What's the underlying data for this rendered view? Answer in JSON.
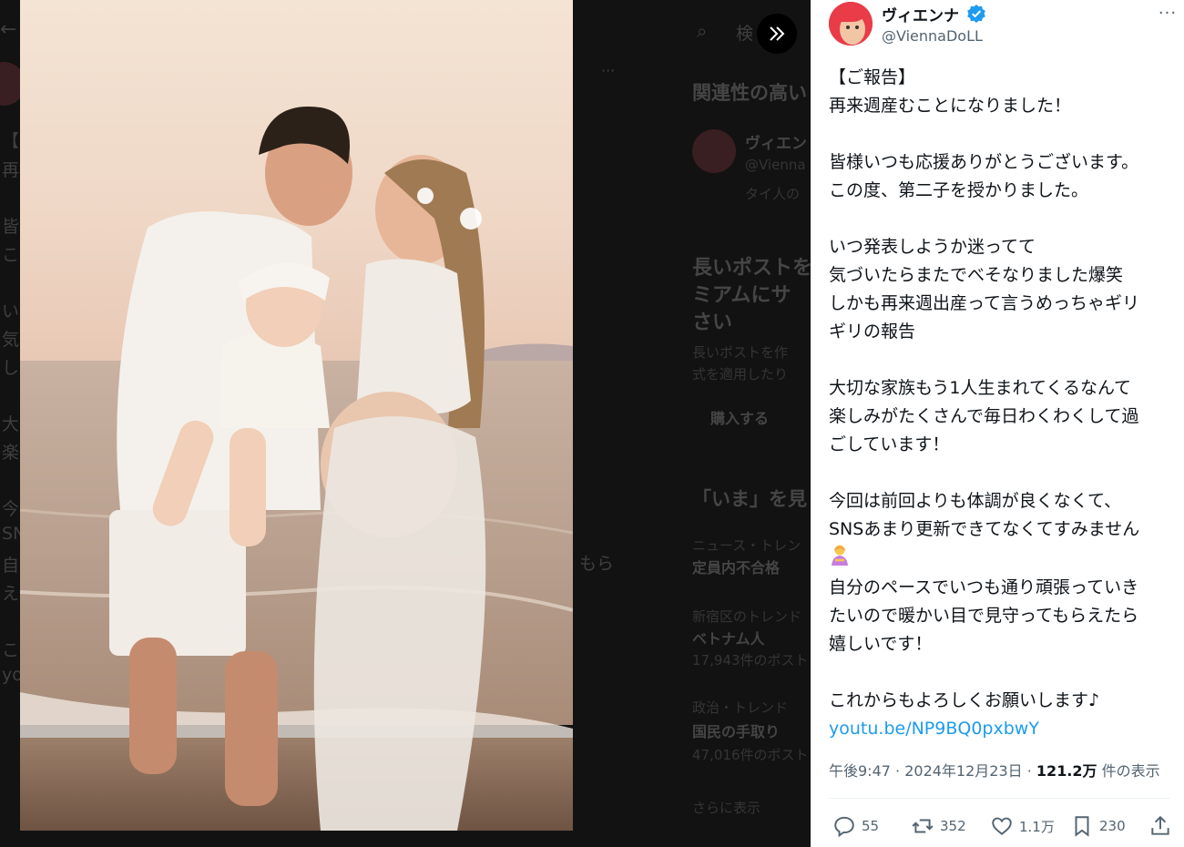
{
  "background": {
    "lines_left": [
      "【",
      "再",
      "皆",
      "こ",
      "い",
      "気",
      "し",
      "大",
      "楽",
      "今",
      "SN",
      "自",
      "え",
      "こ",
      "yo"
    ],
    "search_placeholder": "検",
    "related_heading": "関連性の高い",
    "related_name": "ヴィエン",
    "related_handle": "@Vienna",
    "related_text": "タイ人の",
    "premium_heading_1": "長いポストを",
    "premium_heading_2": "ミアムにサ",
    "premium_heading_3": "さい",
    "premium_text_1": "長いポストを作",
    "premium_text_2": "式を適用したり",
    "buy_button": "購入する",
    "trends_heading": "「いま」を見",
    "trend_1_context": "ニュース・トレン",
    "trend_1_title": "定員内不合格",
    "trend_2_context": "新宿区のトレンド",
    "trend_2_title": "ベトナム人",
    "trend_2_count": "17,943件のポスト",
    "trend_3_context": "政治・トレンド",
    "trend_3_title": "国民の手取り",
    "trend_3_count": "47,016件のポスト",
    "show_more": "さらに表示",
    "partial_text": "もら"
  },
  "tweet": {
    "display_name": "ヴィエンナ",
    "handle": "@ViennaDoLL",
    "lines": [
      "【ご報告】",
      "再来週産むことになりました！",
      "",
      "皆様いつも応援ありがとうございます。",
      "この度、第二子を授かりました。",
      "",
      "いつ発表しようか迷ってて",
      "気づいたらまたでべそなりました爆笑",
      "しかも再来週出産って言うめっちゃギリ",
      "ギリの報告",
      "",
      "大切な家族もう1人生まれてくるなんて",
      "楽しみがたくさんで毎日わくわくして過",
      "ごしています！",
      "",
      "今回は前回よりも体調が良くなくて、",
      "SNSあまり更新できてなくてすみません",
      "",
      "自分のペースでいつも通り頑張っていき",
      "たいので暖かい目で見守ってもらえたら",
      "嬉しいです！",
      "",
      "これからもよろしくお願いします♪"
    ],
    "link": "youtu.be/NP9BQ0pxbwY",
    "time": "午後9:47",
    "date": "2024年12月23日",
    "views": "121.2万",
    "views_label": "件の表示",
    "replies": "55",
    "reposts": "352",
    "likes": "1.1万",
    "bookmarks": "230",
    "emoji_icon": "woman-bowing-emoji"
  },
  "colors": {
    "link": "#1d9bf0",
    "verified": "#1d9bf0",
    "avatar": "#e93b48"
  }
}
